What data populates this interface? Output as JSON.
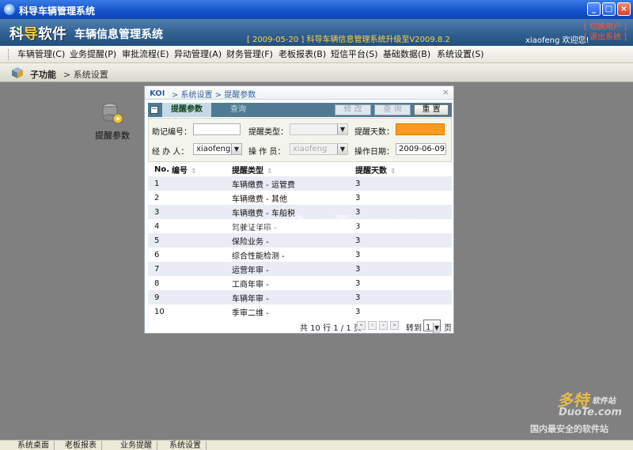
{
  "window": {
    "title": "科导车辆管理系统",
    "min": "_",
    "max": "□",
    "close": "×"
  },
  "header": {
    "brand_part1": "科",
    "brand_part2": "导",
    "brand_part3": "软件",
    "subtitle": "车辆信息管理系统",
    "news": "[ 2009-05-20 ] 科导车辆信息管理系统升级至V2009.8.2",
    "welcome": "xiaofeng 欢迎您!",
    "links": [
      "[ 切换用户 ]",
      "[ 退出系统 ]"
    ]
  },
  "menu": [
    "车辆管理(C)",
    "业务提醒(P)",
    "审批流程(E)",
    "异动管理(A)",
    "财务管理(F)",
    "老板报表(B)",
    "短信平台(S)",
    "基础数据(B)",
    "系统设置(S)"
  ],
  "subbar": {
    "label": "子功能",
    "crumb": "> 系统设置"
  },
  "desktop_icon": {
    "label": "提醒参数"
  },
  "dialog": {
    "path": "> 系统设置 > 提醒参数",
    "close": "×",
    "tabs": [
      "提醒参数",
      "查询"
    ],
    "buttons": [
      "修 改",
      "查 询",
      "重 置"
    ],
    "form": {
      "code_label": "助记编号：",
      "type_label": "提醒类型：",
      "days_label": "提醒天数：",
      "handler_label": "经 办 人：",
      "handler_value": "xiaofeng",
      "operator_label": "操 作 员：",
      "operator_value": "xiaofeng",
      "date_label": "操作日期：",
      "date_value": "2009-06-09"
    },
    "columns": [
      "No.",
      "编号",
      "提醒类型",
      "提醒天数"
    ],
    "rows": [
      {
        "no": "1",
        "code": "",
        "type": "车辆缴费 - 运管费",
        "days": "3"
      },
      {
        "no": "2",
        "code": "",
        "type": "车辆缴费 - 其他",
        "days": "3"
      },
      {
        "no": "3",
        "code": "",
        "type": "车辆缴费 - 车船税",
        "days": "3"
      },
      {
        "no": "4",
        "code": "",
        "type": "驾驶证年审 -",
        "days": "3"
      },
      {
        "no": "5",
        "code": "",
        "type": "保险业务 -",
        "days": "3"
      },
      {
        "no": "6",
        "code": "",
        "type": "综合性能检测 -",
        "days": "3"
      },
      {
        "no": "7",
        "code": "",
        "type": "运营年审 -",
        "days": "3"
      },
      {
        "no": "8",
        "code": "",
        "type": "工商年审 -",
        "days": "3"
      },
      {
        "no": "9",
        "code": "",
        "type": "车辆年审 -",
        "days": "3"
      },
      {
        "no": "10",
        "code": "",
        "type": "季审二维 -",
        "days": "3"
      }
    ],
    "pager": {
      "summary": "共 10 行 1 / 1 页",
      "goto_label": "转到",
      "page_value": "1",
      "page_suffix": "页"
    }
  },
  "watermarks": {
    "center": "www.DuoTe.com",
    "corner_big": "多特",
    "corner_small": "软件站",
    "corner_url": "DuoTe.com",
    "corner_slogan": "国内最安全的软件站"
  },
  "bottom_tabs": [
    "系统桌面",
    "老板报表",
    "业务提醒",
    "系统设置"
  ],
  "colors": {
    "accent": "#4f7a93",
    "highlight": "#ff9a1c",
    "link": "#ff5b2a"
  }
}
